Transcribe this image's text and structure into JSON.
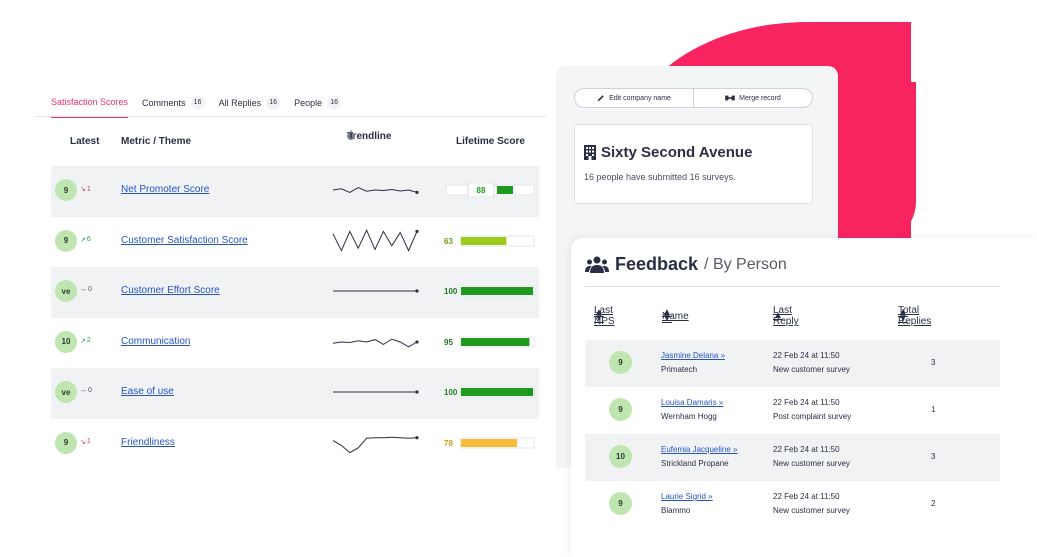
{
  "colors": {
    "brand_pink": "#f7245f",
    "active_tab": "#f0306a",
    "link": "#2554c7",
    "badge_green": "#bfe6b0",
    "bar_green": "#1f9a1f",
    "bar_lime": "#9ccc1a",
    "bar_amber": "#f7bc3a"
  },
  "tabs": [
    {
      "label": "Satisfaction Scores",
      "count": "",
      "active": true
    },
    {
      "label": "Comments",
      "count": "16",
      "active": false
    },
    {
      "label": "All Replies",
      "count": "16",
      "active": false
    },
    {
      "label": "People",
      "count": "16",
      "active": false
    }
  ],
  "scores": {
    "headers": {
      "latest": "Latest",
      "metric": "Metric / Theme",
      "trendline": "Trendline",
      "lifetime": "Lifetime Score"
    },
    "rows": [
      {
        "latest": "9",
        "delta": "1",
        "direction": "down",
        "metric": "Net Promoter Score",
        "lifetime": "88",
        "lifetime_fraction": 0.88,
        "style": "nps",
        "trend": [
          0.5,
          0.55,
          0.4,
          0.6,
          0.45,
          0.5,
          0.48,
          0.52,
          0.46,
          0.5,
          0.4
        ],
        "icon": "trend-down-icon"
      },
      {
        "latest": "9",
        "delta": "6",
        "direction": "up",
        "metric": "Customer Satisfaction Score",
        "lifetime": "63",
        "lifetime_fraction": 0.63,
        "style": "lime",
        "trend": [
          0.8,
          0.1,
          0.9,
          0.2,
          0.95,
          0.15,
          0.9,
          0.3,
          0.85,
          0.1,
          0.9
        ],
        "icon": "trend-up-icon"
      },
      {
        "latest": "ve",
        "delta": "0",
        "direction": "flat",
        "metric": "Customer Effort Score",
        "lifetime": "100",
        "lifetime_fraction": 1.0,
        "style": "green",
        "trend": [
          0.5,
          0.5,
          0.5,
          0.5,
          0.5,
          0.5,
          0.5,
          0.5,
          0.5,
          0.5,
          0.5
        ],
        "icon": "trend-flat-icon"
      },
      {
        "latest": "10",
        "delta": "2",
        "direction": "up",
        "metric": "Communication",
        "lifetime": "95",
        "lifetime_fraction": 0.95,
        "style": "green",
        "trend": [
          0.45,
          0.5,
          0.48,
          0.55,
          0.5,
          0.6,
          0.4,
          0.62,
          0.5,
          0.3,
          0.5
        ],
        "icon": "trend-up-icon"
      },
      {
        "latest": "ve",
        "delta": "0",
        "direction": "flat",
        "metric": "Ease of use",
        "lifetime": "100",
        "lifetime_fraction": 1.0,
        "style": "green",
        "trend": [
          0.5,
          0.5,
          0.5,
          0.5,
          0.5,
          0.5,
          0.5,
          0.5,
          0.5,
          0.5,
          0.5
        ],
        "icon": "trend-flat-icon"
      },
      {
        "latest": "9",
        "delta": "1",
        "direction": "down",
        "metric": "Friendliness",
        "lifetime": "78",
        "lifetime_fraction": 0.78,
        "style": "amber",
        "trend": [
          0.6,
          0.4,
          0.1,
          0.3,
          0.7,
          0.72,
          0.72,
          0.74,
          0.72,
          0.7,
          0.72
        ],
        "icon": "trend-down-icon"
      }
    ]
  },
  "company": {
    "edit_label": "Edit company name",
    "merge_label": "Merge record",
    "name": "Sixty Second Avenue",
    "summary": "16 people have submitted 16 surveys."
  },
  "feedback": {
    "title": "Feedback",
    "subtitle": "/ By Person",
    "headers": {
      "nps": "Last NPS",
      "name": "Name",
      "reply": "Last Reply",
      "total": "Total Replies"
    },
    "rows": [
      {
        "nps": "9",
        "name": "Jasmine Delana »",
        "company": "Primatech",
        "date": "22 Feb 24 at 11:50",
        "survey": "New customer survey",
        "total": "3"
      },
      {
        "nps": "9",
        "name": "Louisa Damaris »",
        "company": "Wernham Hogg",
        "date": "22 Feb 24 at 11:50",
        "survey": "Post complaint survey",
        "total": "1"
      },
      {
        "nps": "10",
        "name": "Eufemia Jacqueline »",
        "company": "Strickland Propane",
        "date": "22 Feb 24 at 11:50",
        "survey": "New customer survey",
        "total": "3"
      },
      {
        "nps": "9",
        "name": "Laurie Sigrid »",
        "company": "Blammo",
        "date": "22 Feb 24 at 11:50",
        "survey": "New customer survey",
        "total": "2"
      }
    ]
  }
}
